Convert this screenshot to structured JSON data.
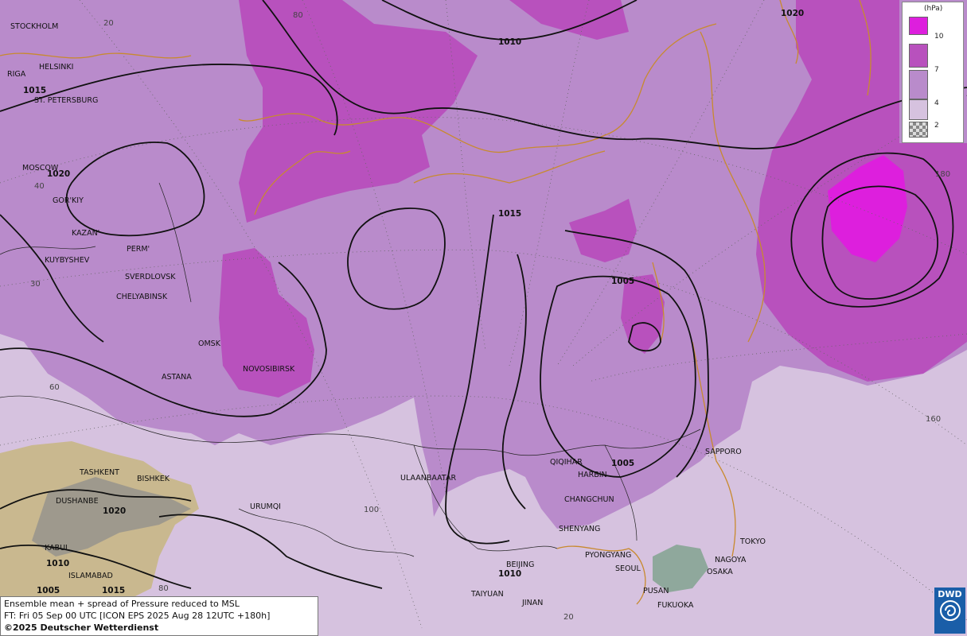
{
  "legend": {
    "unit": "(hPa)",
    "levels": [
      "10",
      "7",
      "4",
      "2"
    ],
    "colors": [
      "#dd1fdd",
      "#b851bd",
      "#b98bcb",
      "#d6c2df"
    ]
  },
  "info": {
    "line1": "Ensemble mean + spread of Pressure reduced to MSL",
    "line2": "FT: Fri 05 Sep 00 UTC [ICON EPS 2025 Aug 28 12UTC +180h]",
    "copyright": "©2025 Deutscher Wetterdienst"
  },
  "logo": {
    "text": "DWD"
  },
  "cities": {
    "stockholm": "STOCKHOLM",
    "helsinki": "HELSINKI",
    "riga": "RIGA",
    "st_petersburg": "ST. PETERSBURG",
    "moscow": "MOSCOW",
    "gorkiy": "GOR'KIY",
    "kazan": "KAZAN'",
    "kuybyshev": "KUYBYSHEV",
    "perm": "PERM'",
    "sverdlovsk": "SVERDLOVSK",
    "chelyabinsk": "CHELYABINSK",
    "omsk": "OMSK",
    "novosibirsk": "NOVOSIBIRSK",
    "astana": "ASTANA",
    "tashkent": "TASHKENT",
    "bishkek": "BISHKEK",
    "dushanbe": "DUSHANBE",
    "kabul": "KABUL",
    "islamabad": "ISLAMABAD",
    "urumqi": "URUMQI",
    "ulaanbaatar": "ULAANBAATAR",
    "qiqihar": "QIQIHAR",
    "harbin": "HARBIN",
    "changchun": "CHANGCHUN",
    "shenyang": "SHENYANG",
    "pyongyang": "PYONGYANG",
    "seoul": "SEOUL",
    "pusan": "PUSAN",
    "fukuoka": "FUKUOKA",
    "osaka": "OSAKA",
    "nagoya": "NAGOYA",
    "tokyo": "TOKYO",
    "sapporo": "SAPPORO",
    "beijing": "BEIJING",
    "taiyuan": "TAIYUAN",
    "jinan": "JINAN"
  },
  "isobars": {
    "i1010_n": "1010",
    "i1020_ne": "1020",
    "i1015_w": "1015",
    "i1020_w": "1020",
    "i1015_c": "1015",
    "i1005_c": "1005",
    "i1005_s": "1005",
    "i1020_sw": "1020",
    "i1010_sw": "1010",
    "i1005_sw": "1005",
    "i1015_sw": "1015",
    "i1010_s": "1010"
  },
  "grid_labels": {
    "g20": "20",
    "g80": "80",
    "g40": "40",
    "g30": "30",
    "g60": "60",
    "g180": "180",
    "g160": "160",
    "g100": "100",
    "g80b": "80",
    "g20b": "20"
  }
}
